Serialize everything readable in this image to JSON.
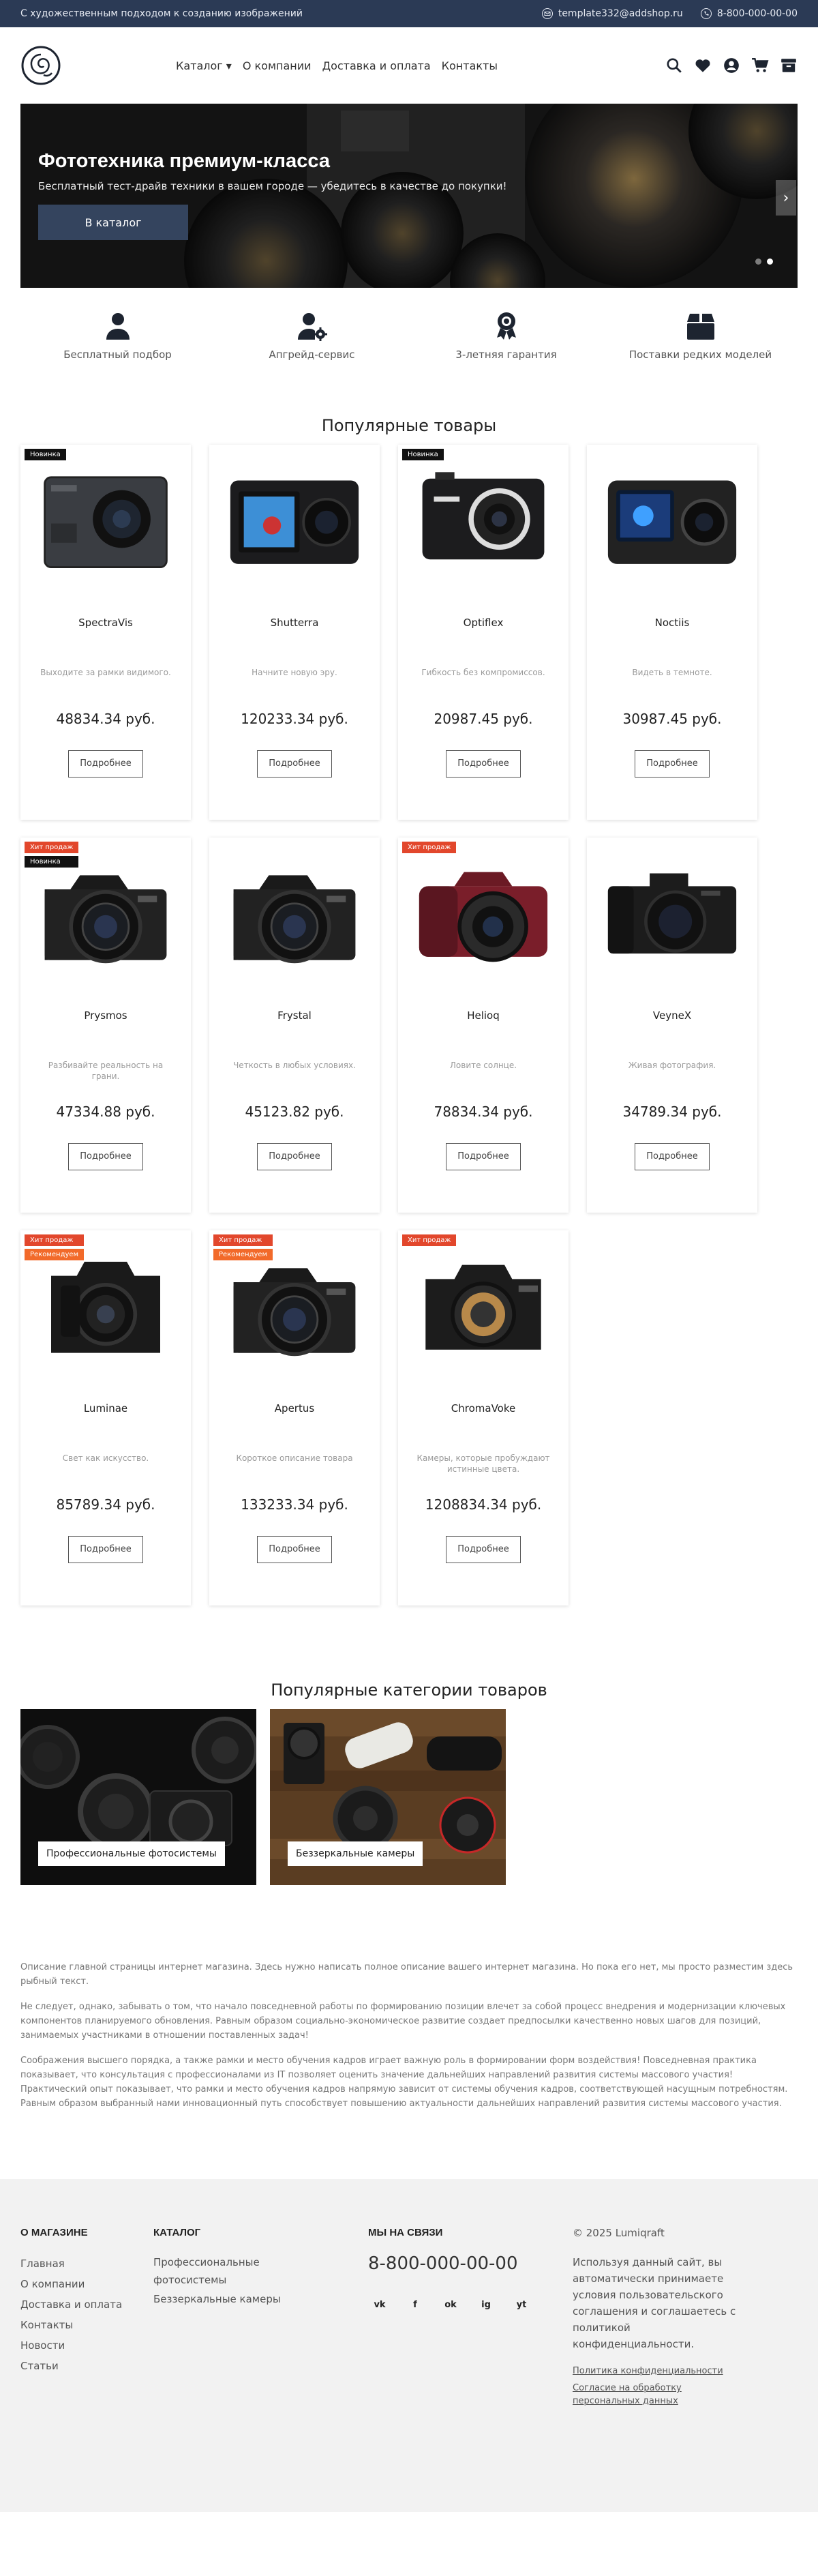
{
  "topbar": {
    "tagline": "С художественным подходом к созданию изображений",
    "email": "template332@addshop.ru",
    "phone": "8-800-000-00-00"
  },
  "nav": {
    "catalog": "Каталог ▾",
    "about": "О компании",
    "delivery": "Доставка и оплата",
    "contacts": "Контакты"
  },
  "hero": {
    "title": "Фототехника премиум-класса",
    "subtitle": "Бесплатный тест-драйв техники в вашем городе — убедитесь в качестве до покупки!",
    "button": "В каталог",
    "next": "›"
  },
  "features": [
    {
      "label": "Бесплатный подбор",
      "icon": "user-icon"
    },
    {
      "label": "Апгрейд-сервис",
      "icon": "user-gear-icon"
    },
    {
      "label": "3-летняя гарантия",
      "icon": "award-icon"
    },
    {
      "label": "Поставки редких моделей",
      "icon": "box-icon"
    }
  ],
  "products_title": "Популярные товары",
  "products": [
    {
      "name": "SpectraVis",
      "desc": "Выходите за рамки видимого.",
      "price": "48834.34 руб.",
      "badges": [
        "Новинка"
      ],
      "more": "Подробнее",
      "kind": "action"
    },
    {
      "name": "Shutterra",
      "desc": "Начните новую эру.",
      "price": "120233.34 руб.",
      "badges": [],
      "more": "Подробнее",
      "kind": "action2"
    },
    {
      "name": "Optiflex",
      "desc": "Гибкость без компромиссов.",
      "price": "20987.45 руб.",
      "badges": [
        "Новинка"
      ],
      "more": "Подробнее",
      "kind": "compact"
    },
    {
      "name": "Noctiis",
      "desc": "Видеть в темноте.",
      "price": "30987.45 руб.",
      "badges": [],
      "more": "Подробнее",
      "kind": "action3"
    },
    {
      "name": "Prysmos",
      "desc": "Разбивайте реальность на грани.",
      "price": "47334.88 руб.",
      "badges": [
        "Хит продаж",
        "Новинка"
      ],
      "more": "Подробнее",
      "kind": "dslr"
    },
    {
      "name": "Frystal",
      "desc": "Четкость в любых условиях.",
      "price": "45123.82 руб.",
      "badges": [],
      "more": "Подробнее",
      "kind": "dslr"
    },
    {
      "name": "Helioq",
      "desc": "Ловите солнце.",
      "price": "78834.34 руб.",
      "badges": [
        "Хит продаж"
      ],
      "more": "Подробнее",
      "kind": "bridge"
    },
    {
      "name": "VeyneX",
      "desc": "Живая фотография.",
      "price": "34789.34 руб.",
      "badges": [],
      "more": "Подробнее",
      "kind": "mirrorless"
    },
    {
      "name": "Luminae",
      "desc": "Свет как искусство.",
      "price": "85789.34 руб.",
      "badges": [
        "Хит продаж",
        "Рекомендуем"
      ],
      "more": "Подробнее",
      "kind": "body"
    },
    {
      "name": "Apertus",
      "desc": "Короткое описание товара",
      "price": "133233.34 руб.",
      "badges": [
        "Хит продаж",
        "Рекомендуем"
      ],
      "more": "Подробнее",
      "kind": "dslr"
    },
    {
      "name": "ChromaVoke",
      "desc": "Камеры, которые пробуждают истинные цвета.",
      "price": "1208834.34 руб.",
      "badges": [
        "Хит продаж"
      ],
      "more": "Подробнее",
      "kind": "body2"
    }
  ],
  "categories_title": "Популярные категории товаров",
  "categories": [
    {
      "label": "Профессиональные фотосистемы"
    },
    {
      "label": "Беззеркальные камеры"
    }
  ],
  "text": [
    "Описание главной страницы интернет магазина. Здесь нужно написать полное описание вашего интернет магазина. Но пока его нет, мы просто разместим здесь рыбный текст.",
    "Не следует, однако, забывать о том, что начало повседневной работы по формированию позиции влечет за собой процесс внедрения и модернизации ключевых компонентов планируемого обновления. Равным образом социально-экономическое развитие создает предпосылки качественно новых шагов для позиций, занимаемых участниками в отношении поставленных задач!",
    "Соображения высшего порядка, а также рамки и место обучения кадров играет важную роль в формировании форм воздействия! Повседневная практика показывает, что консультация с профессионалами из IT позволяет оценить значение дальнейших направлений развития системы массового участия! Практический опыт показывает, что рамки и место обучения кадров напрямую зависит от системы обучения кадров, соответствующей насущным потребностям. Равным образом выбранный нами инновационный путь способствует повышению актуальности дальнейших направлений развития системы массового участия."
  ],
  "footer": {
    "about_title": "О МАГАЗИНЕ",
    "about_links": [
      "Главная",
      "О компании",
      "Доставка и оплата",
      "Контакты",
      "Новости",
      "Статьи"
    ],
    "catalog_title": "КАТАЛОГ",
    "catalog_links": [
      "Профессиональные фотосистемы",
      "Беззеркальные камеры"
    ],
    "contact_title": "МЫ НА СВЯЗИ",
    "phone": "8-800-000-00-00",
    "socials": [
      "vk",
      "f",
      "ok",
      "ig",
      "yt"
    ],
    "copyright": "© 2025 Lumiqraft",
    "notice": "Используя данный сайт, вы автоматически принимаете условия пользовательского соглашения и соглашаетесь с политикой конфиденциальности.",
    "privacy": "Политика конфиденциальности",
    "consent": "Согласие на обработку персональных данных"
  }
}
